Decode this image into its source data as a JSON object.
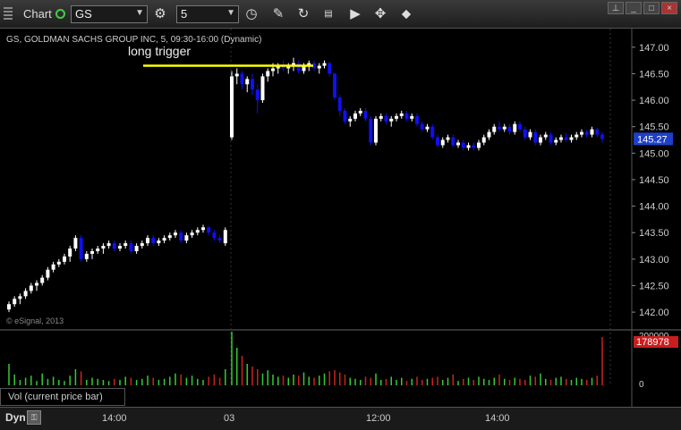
{
  "toolbar": {
    "title": "Chart",
    "symbol": "GS",
    "interval": "5",
    "icons": [
      "clock-icon",
      "pencil-icon",
      "refresh-icon",
      "gallery-icon",
      "play-icon",
      "tools-icon"
    ]
  },
  "window": {
    "pin": "push-pin-icon",
    "minimize": "_",
    "maximize": "□",
    "close": "×"
  },
  "chart_header": "GS, GOLDMAN SACHS GROUP INC, 5, 09:30-16:00 (Dynamic)",
  "watermark": "© eSignal, 2013",
  "annotation": "long trigger",
  "vol_label": "Vol (current price bar)",
  "bottom": {
    "mode": "Dyn",
    "x_labels": [
      "14:00",
      "03",
      "12:00",
      "14:00"
    ]
  },
  "chart_data": {
    "type": "candlestick",
    "price_axis": {
      "ticks": [
        "147.00",
        "146.50",
        "146.00",
        "145.50",
        "145.00",
        "144.50",
        "144.00",
        "143.50",
        "143.00",
        "142.50",
        "142.00"
      ],
      "current": "145.27",
      "ylim": [
        141.85,
        147.25
      ]
    },
    "volume_axis": {
      "ticks": [
        "200000",
        "0"
      ],
      "current": "178978"
    },
    "trigger_level": 146.65,
    "colors": {
      "up": "#ffffff",
      "down": "#1010ee",
      "trigger": "#ffff00",
      "vol_up": "#33cc33",
      "vol_down": "#cc2222",
      "price_badge": "#1e40c8",
      "vol_badge": "#c81e1e"
    },
    "day1": [
      [
        142.05,
        142.2,
        142.0,
        142.15
      ],
      [
        142.15,
        142.3,
        142.1,
        142.25
      ],
      [
        142.25,
        142.35,
        142.15,
        142.3
      ],
      [
        142.3,
        142.45,
        142.25,
        142.4
      ],
      [
        142.4,
        142.55,
        142.35,
        142.5
      ],
      [
        142.5,
        142.6,
        142.4,
        142.55
      ],
      [
        142.55,
        142.7,
        142.5,
        142.65
      ],
      [
        142.65,
        142.85,
        142.6,
        142.8
      ],
      [
        142.8,
        142.95,
        142.75,
        142.9
      ],
      [
        142.9,
        143.0,
        142.85,
        142.95
      ],
      [
        142.95,
        143.1,
        142.9,
        143.05
      ],
      [
        143.05,
        143.25,
        142.95,
        143.2
      ],
      [
        143.2,
        143.45,
        143.15,
        143.4
      ],
      [
        143.4,
        143.45,
        142.95,
        143.0
      ],
      [
        143.0,
        143.15,
        142.95,
        143.1
      ],
      [
        143.1,
        143.2,
        143.0,
        143.15
      ],
      [
        143.15,
        143.25,
        143.1,
        143.2
      ],
      [
        143.2,
        143.3,
        143.1,
        143.25
      ],
      [
        143.25,
        143.35,
        143.2,
        143.3
      ],
      [
        143.3,
        143.35,
        143.15,
        143.2
      ],
      [
        143.2,
        143.3,
        143.15,
        143.25
      ],
      [
        143.25,
        143.35,
        143.2,
        143.3
      ],
      [
        143.3,
        143.35,
        143.1,
        143.15
      ],
      [
        143.15,
        143.3,
        143.1,
        143.25
      ],
      [
        143.25,
        143.35,
        143.2,
        143.3
      ],
      [
        143.3,
        143.45,
        143.25,
        143.4
      ],
      [
        143.4,
        143.45,
        143.25,
        143.3
      ],
      [
        143.3,
        143.4,
        143.25,
        143.35
      ],
      [
        143.35,
        143.45,
        143.3,
        143.4
      ],
      [
        143.4,
        143.5,
        143.35,
        143.45
      ],
      [
        143.45,
        143.55,
        143.4,
        143.5
      ],
      [
        143.5,
        143.55,
        143.3,
        143.35
      ],
      [
        143.35,
        143.5,
        143.3,
        143.45
      ],
      [
        143.45,
        143.55,
        143.4,
        143.5
      ],
      [
        143.5,
        143.6,
        143.45,
        143.55
      ],
      [
        143.55,
        143.65,
        143.5,
        143.6
      ],
      [
        143.6,
        143.62,
        143.45,
        143.5
      ],
      [
        143.5,
        143.55,
        143.35,
        143.4
      ],
      [
        143.4,
        143.45,
        143.3,
        143.35
      ],
      [
        143.3,
        143.6,
        143.25,
        143.55
      ]
    ],
    "day2": [
      [
        145.3,
        146.55,
        145.25,
        146.45
      ],
      [
        146.45,
        146.6,
        146.3,
        146.5
      ],
      [
        146.5,
        146.55,
        146.2,
        146.3
      ],
      [
        146.3,
        146.45,
        146.15,
        146.4
      ],
      [
        146.4,
        146.5,
        146.1,
        146.2
      ],
      [
        146.2,
        146.3,
        145.75,
        146.0
      ],
      [
        146.0,
        146.5,
        145.95,
        146.45
      ],
      [
        146.45,
        146.6,
        146.35,
        146.55
      ],
      [
        146.55,
        146.7,
        146.45,
        146.6
      ],
      [
        146.6,
        146.7,
        146.5,
        146.65
      ],
      [
        146.65,
        146.75,
        146.55,
        146.6
      ],
      [
        146.6,
        146.7,
        146.5,
        146.65
      ],
      [
        146.65,
        146.8,
        146.55,
        146.7
      ],
      [
        146.7,
        146.75,
        146.5,
        146.55
      ],
      [
        146.55,
        146.7,
        146.5,
        146.65
      ],
      [
        146.65,
        146.75,
        146.55,
        146.7
      ],
      [
        146.7,
        146.75,
        146.55,
        146.6
      ],
      [
        146.6,
        146.7,
        146.5,
        146.65
      ],
      [
        146.65,
        146.75,
        146.6,
        146.7
      ],
      [
        146.7,
        146.72,
        146.45,
        146.5
      ],
      [
        146.5,
        146.52,
        146.0,
        146.05
      ],
      [
        146.05,
        146.1,
        145.7,
        145.8
      ],
      [
        145.8,
        145.85,
        145.55,
        145.6
      ],
      [
        145.6,
        145.7,
        145.5,
        145.65
      ],
      [
        145.65,
        145.8,
        145.6,
        145.75
      ],
      [
        145.75,
        145.85,
        145.7,
        145.8
      ],
      [
        145.8,
        145.85,
        145.6,
        145.65
      ],
      [
        145.65,
        145.7,
        145.15,
        145.2
      ],
      [
        145.2,
        145.7,
        145.15,
        145.65
      ],
      [
        145.65,
        145.75,
        145.6,
        145.7
      ],
      [
        145.7,
        145.75,
        145.55,
        145.6
      ],
      [
        145.6,
        145.7,
        145.5,
        145.65
      ],
      [
        145.65,
        145.75,
        145.6,
        145.7
      ],
      [
        145.7,
        145.8,
        145.65,
        145.75
      ],
      [
        145.75,
        145.8,
        145.6,
        145.65
      ],
      [
        145.65,
        145.75,
        145.6,
        145.7
      ],
      [
        145.7,
        145.75,
        145.5,
        145.55
      ],
      [
        145.55,
        145.6,
        145.4,
        145.45
      ],
      [
        145.45,
        145.55,
        145.4,
        145.5
      ],
      [
        145.5,
        145.55,
        145.25,
        145.3
      ],
      [
        145.3,
        145.35,
        145.1,
        145.15
      ],
      [
        145.15,
        145.3,
        145.1,
        145.25
      ],
      [
        145.25,
        145.35,
        145.2,
        145.3
      ],
      [
        145.3,
        145.35,
        145.1,
        145.15
      ],
      [
        145.15,
        145.25,
        145.1,
        145.2
      ],
      [
        145.2,
        145.25,
        145.05,
        145.1
      ],
      [
        145.1,
        145.2,
        145.05,
        145.15
      ],
      [
        145.15,
        145.2,
        145.05,
        145.1
      ],
      [
        145.1,
        145.25,
        145.05,
        145.2
      ],
      [
        145.2,
        145.35,
        145.15,
        145.3
      ],
      [
        145.3,
        145.45,
        145.25,
        145.4
      ],
      [
        145.4,
        145.55,
        145.35,
        145.5
      ],
      [
        145.5,
        145.6,
        145.4,
        145.45
      ],
      [
        145.45,
        145.55,
        145.4,
        145.5
      ],
      [
        145.5,
        145.55,
        145.35,
        145.4
      ],
      [
        145.4,
        145.6,
        145.35,
        145.55
      ],
      [
        145.55,
        145.6,
        145.4,
        145.45
      ],
      [
        145.45,
        145.5,
        145.25,
        145.3
      ],
      [
        145.3,
        145.45,
        145.25,
        145.4
      ],
      [
        145.4,
        145.45,
        145.15,
        145.2
      ],
      [
        145.2,
        145.35,
        145.15,
        145.3
      ],
      [
        145.3,
        145.4,
        145.25,
        145.35
      ],
      [
        145.35,
        145.4,
        145.15,
        145.2
      ],
      [
        145.2,
        145.3,
        145.15,
        145.25
      ],
      [
        145.25,
        145.35,
        145.2,
        145.3
      ],
      [
        145.3,
        145.38,
        145.22,
        145.25
      ],
      [
        145.25,
        145.35,
        145.2,
        145.3
      ],
      [
        145.3,
        145.4,
        145.25,
        145.35
      ],
      [
        145.35,
        145.45,
        145.3,
        145.4
      ],
      [
        145.4,
        145.45,
        145.3,
        145.35
      ],
      [
        145.35,
        145.5,
        145.3,
        145.45
      ],
      [
        145.45,
        145.48,
        145.3,
        145.35
      ],
      [
        145.35,
        145.4,
        145.2,
        145.27
      ]
    ],
    "vol1": [
      40,
      20,
      10,
      14,
      18,
      8,
      22,
      12,
      16,
      10,
      8,
      18,
      30,
      26,
      10,
      14,
      12,
      10,
      8,
      12,
      10,
      16,
      14,
      10,
      12,
      18,
      14,
      10,
      12,
      16,
      22,
      20,
      14,
      18,
      12,
      10,
      16,
      20,
      14,
      30
    ],
    "vol2": [
      100,
      70,
      55,
      40,
      35,
      30,
      22,
      28,
      20,
      16,
      18,
      14,
      20,
      18,
      24,
      16,
      14,
      18,
      22,
      26,
      28,
      24,
      20,
      14,
      12,
      10,
      16,
      14,
      22,
      10,
      12,
      16,
      10,
      14,
      8,
      12,
      16,
      10,
      12,
      14,
      16,
      10,
      14,
      20,
      8,
      12,
      14,
      10,
      16,
      12,
      10,
      14,
      20,
      12,
      10,
      14,
      12,
      10,
      18,
      16,
      22,
      12,
      10,
      14,
      16,
      12,
      10,
      14,
      12,
      10,
      14,
      18,
      90
    ]
  }
}
